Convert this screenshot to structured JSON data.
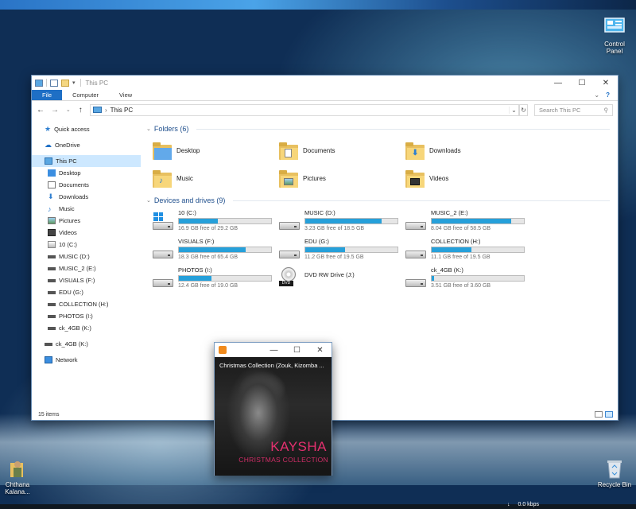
{
  "desktop": {
    "icons": [
      {
        "label_line1": "Control",
        "label_line2": "Panel"
      },
      {
        "label_line1": "Chthana",
        "label_line2": "Kalana..."
      },
      {
        "label_line1": "Recycle Bin",
        "label_line2": ""
      }
    ]
  },
  "explorer": {
    "title": "This PC",
    "ribbon_tabs": [
      "File",
      "Computer",
      "View"
    ],
    "address": "This PC",
    "search_placeholder": "Search This PC",
    "nav": [
      {
        "label": "Quick access"
      },
      {
        "label": "OneDrive"
      },
      {
        "label": "This PC"
      },
      {
        "label": "Desktop"
      },
      {
        "label": "Documents"
      },
      {
        "label": "Downloads"
      },
      {
        "label": "Music"
      },
      {
        "label": "Pictures"
      },
      {
        "label": "Videos"
      },
      {
        "label": "10 (C:)"
      },
      {
        "label": "MUSIC (D:)"
      },
      {
        "label": "MUSIC_2 (E:)"
      },
      {
        "label": "VISUALS (F:)"
      },
      {
        "label": "EDU (G:)"
      },
      {
        "label": "COLLECTION (H:)"
      },
      {
        "label": "PHOTOS (I:)"
      },
      {
        "label": "ck_4GB (K:)"
      },
      {
        "label": "ck_4GB (K:)"
      },
      {
        "label": "Network"
      }
    ],
    "folders_header": "Folders (6)",
    "folders": [
      {
        "name": "Desktop"
      },
      {
        "name": "Documents"
      },
      {
        "name": "Downloads"
      },
      {
        "name": "Music"
      },
      {
        "name": "Pictures"
      },
      {
        "name": "Videos"
      }
    ],
    "drives_header": "Devices and drives (9)",
    "drives": [
      {
        "name": "10 (C:)",
        "free": "16.9 GB free of 29.2 GB",
        "used_fraction": 0.42
      },
      {
        "name": "MUSIC (D:)",
        "free": "3.23 GB free of 18.5 GB",
        "used_fraction": 0.83
      },
      {
        "name": "MUSIC_2 (E:)",
        "free": "8.04 GB free of 58.5 GB",
        "used_fraction": 0.86
      },
      {
        "name": "VISUALS (F:)",
        "free": "18.3 GB free of 65.4 GB",
        "used_fraction": 0.72
      },
      {
        "name": "EDU (G:)",
        "free": "11.2 GB free of 19.5 GB",
        "used_fraction": 0.43
      },
      {
        "name": "COLLECTION (H:)",
        "free": "11.1 GB free of 19.5 GB",
        "used_fraction": 0.43
      },
      {
        "name": "PHOTOS (I:)",
        "free": "12.4 GB free of 19.0 GB",
        "used_fraction": 0.35
      },
      {
        "name": "DVD RW Drive (J:)",
        "free": "",
        "used_fraction": null
      },
      {
        "name": "ck_4GB (K:)",
        "free": "3.51 GB free of 3.60 GB",
        "used_fraction": 0.03
      }
    ],
    "status": "15 items"
  },
  "player": {
    "caption": "Christmas Collection (Zouk, Kizomba ...",
    "artist": "KAYSHA",
    "album": "CHRISTMAS COLLECTION"
  },
  "tray": {
    "network_speed": "0.0 kbps"
  },
  "colors": {
    "accent": "#1e6fc5",
    "drive_bar": "#26a0da",
    "album_text": "#e4306f"
  }
}
